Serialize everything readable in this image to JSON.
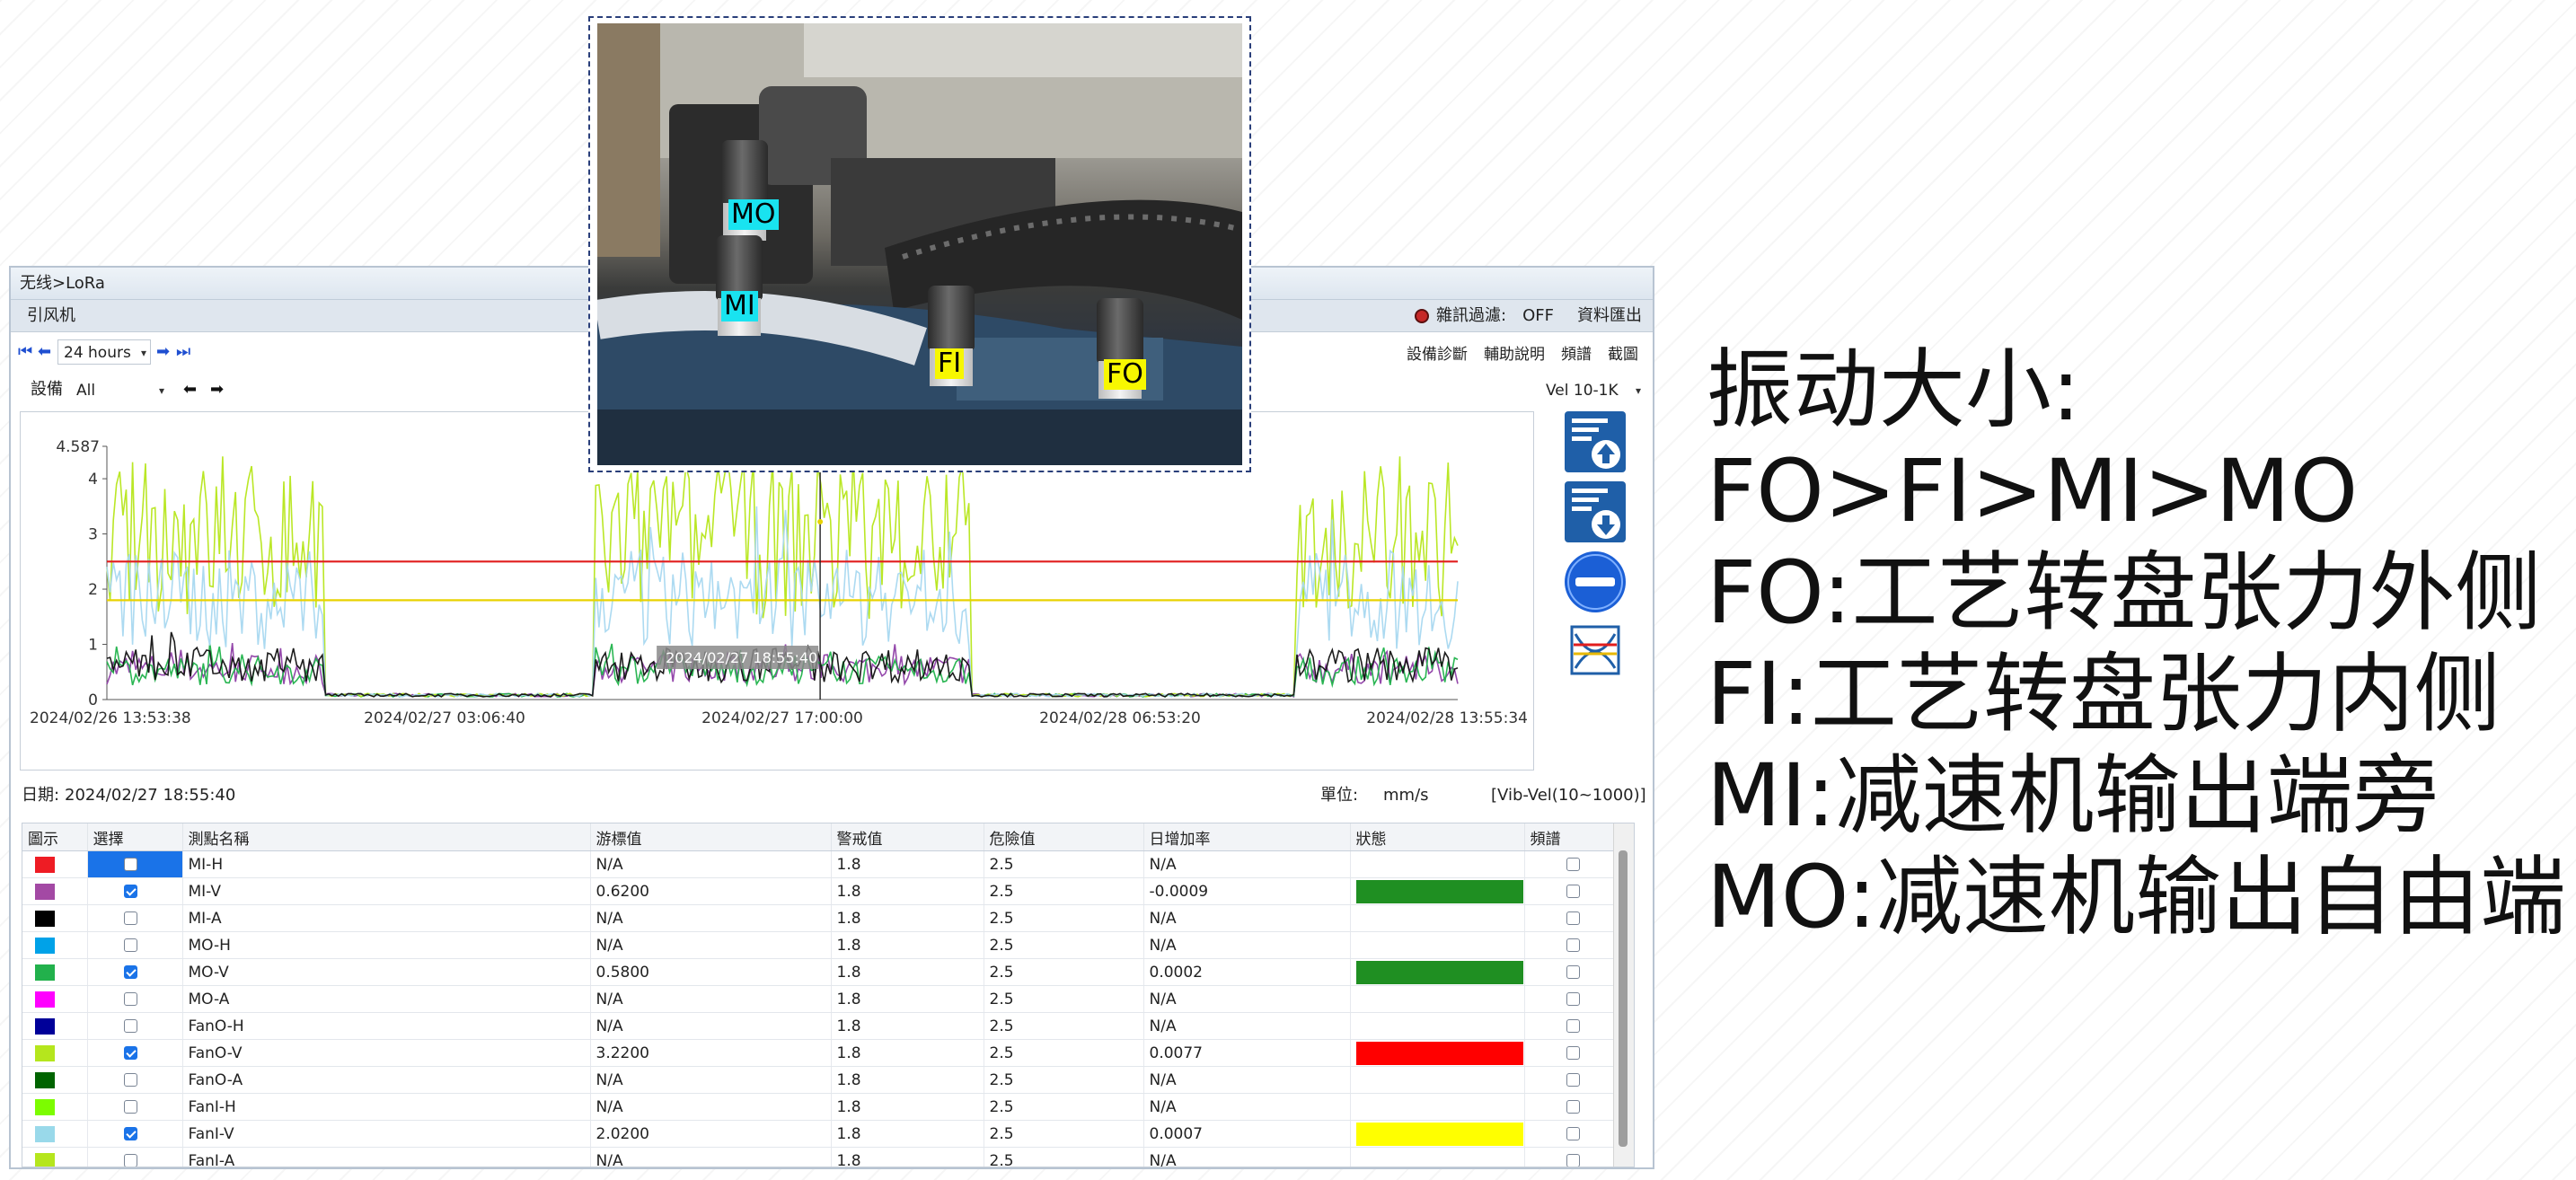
{
  "window": {
    "breadcrumb": "无线>LoRa",
    "device_title": "引风机",
    "noise_filter_label": "雜訊過濾:",
    "noise_filter_value": "OFF",
    "export_label": "資料匯出"
  },
  "toolbar": {
    "time_range": "24 hours",
    "device_label": "設備",
    "device_value": "All",
    "menu_items": [
      "設備診斷",
      "輔助說明",
      "頻譜",
      "截圖"
    ],
    "measurement": "Vel 10-1K"
  },
  "chart_data": {
    "type": "line",
    "ymax_label": "4.587",
    "y_ticks": [
      0,
      1,
      2,
      3,
      4
    ],
    "ylim": [
      0,
      4.587
    ],
    "x_tick_labels": [
      "2024/02/26 13:53:38",
      "2024/02/27 03:06:40",
      "2024/02/27 17:00:00",
      "2024/02/28 06:53:20",
      "2024/02/28 13:55:34"
    ],
    "cursor_label": "2024/02/27 18:55:40",
    "threshold_lines": [
      {
        "name": "危險值",
        "value": 2.5,
        "color": "#e11d1d"
      },
      {
        "name": "警戒值",
        "value": 1.8,
        "color": "#e8d200"
      }
    ],
    "active_segments": [
      [
        0.0,
        0.16
      ],
      [
        0.36,
        0.64
      ],
      [
        0.88,
        1.0
      ]
    ],
    "series": [
      {
        "color": "#8e3ea6",
        "level": 0.62
      },
      {
        "color": "#1fb24a",
        "level": 0.58
      },
      {
        "color": "#b6e61a",
        "level": 3.22
      },
      {
        "color": "#a8d8f0",
        "level": 2.02
      },
      {
        "color": "#111111",
        "level": 0.7
      }
    ]
  },
  "datebar": {
    "date_label": "日期:",
    "date_value": "2024/02/27 18:55:40",
    "unit_label": "單位:",
    "unit_value": "mm/s",
    "range_value": "[Vib-Vel(10~1000)]"
  },
  "table": {
    "headers": [
      "圖示",
      "選擇",
      "測點名稱",
      "游標值",
      "警戒值",
      "危險值",
      "日增加率",
      "狀態",
      "頻譜"
    ],
    "rows": [
      {
        "color": "#ee1c24",
        "checked": false,
        "name": "MI-H",
        "cursor": "N/A",
        "warn": "1.8",
        "danger": "2.5",
        "rate": "N/A",
        "status": "",
        "selected": true
      },
      {
        "color": "#a349a4",
        "checked": true,
        "name": "MI-V",
        "cursor": "0.6200",
        "warn": "1.8",
        "danger": "2.5",
        "rate": "-0.0009",
        "status": "#1f8f22"
      },
      {
        "color": "#000000",
        "checked": false,
        "name": "MI-A",
        "cursor": "N/A",
        "warn": "1.8",
        "danger": "2.5",
        "rate": "N/A",
        "status": ""
      },
      {
        "color": "#00a2e8",
        "checked": false,
        "name": "MO-H",
        "cursor": "N/A",
        "warn": "1.8",
        "danger": "2.5",
        "rate": "N/A",
        "status": ""
      },
      {
        "color": "#22b14c",
        "checked": true,
        "name": "MO-V",
        "cursor": "0.5800",
        "warn": "1.8",
        "danger": "2.5",
        "rate": "0.0002",
        "status": "#1f8f22"
      },
      {
        "color": "#ff00ff",
        "checked": false,
        "name": "MO-A",
        "cursor": "N/A",
        "warn": "1.8",
        "danger": "2.5",
        "rate": "N/A",
        "status": ""
      },
      {
        "color": "#000099",
        "checked": false,
        "name": "FanO-H",
        "cursor": "N/A",
        "warn": "1.8",
        "danger": "2.5",
        "rate": "N/A",
        "status": ""
      },
      {
        "color": "#b5e61d",
        "checked": true,
        "name": "FanO-V",
        "cursor": "3.2200",
        "warn": "1.8",
        "danger": "2.5",
        "rate": "0.0077",
        "status": "#ff0000"
      },
      {
        "color": "#006400",
        "checked": false,
        "name": "FanO-A",
        "cursor": "N/A",
        "warn": "1.8",
        "danger": "2.5",
        "rate": "N/A",
        "status": ""
      },
      {
        "color": "#7cfc00",
        "checked": false,
        "name": "FanI-H",
        "cursor": "N/A",
        "warn": "1.8",
        "danger": "2.5",
        "rate": "N/A",
        "status": ""
      },
      {
        "color": "#99d9ea",
        "checked": true,
        "name": "FanI-V",
        "cursor": "2.0200",
        "warn": "1.8",
        "danger": "2.5",
        "rate": "0.0007",
        "status": "#ffff00"
      },
      {
        "color": "#b5e61d",
        "checked": false,
        "name": "FanI-A",
        "cursor": "N/A",
        "warn": "1.8",
        "danger": "2.5",
        "rate": "N/A",
        "status": ""
      }
    ]
  },
  "photo": {
    "tags": [
      "MO",
      "MI",
      "FI",
      "FO"
    ]
  },
  "notes": [
    "振动大小:",
    "FO>FI>MI>MO",
    "FO:工艺转盘张力外侧",
    "FI:工艺转盘张力内侧",
    "MI:减速机输出端旁",
    "MO:减速机输出自由端"
  ]
}
